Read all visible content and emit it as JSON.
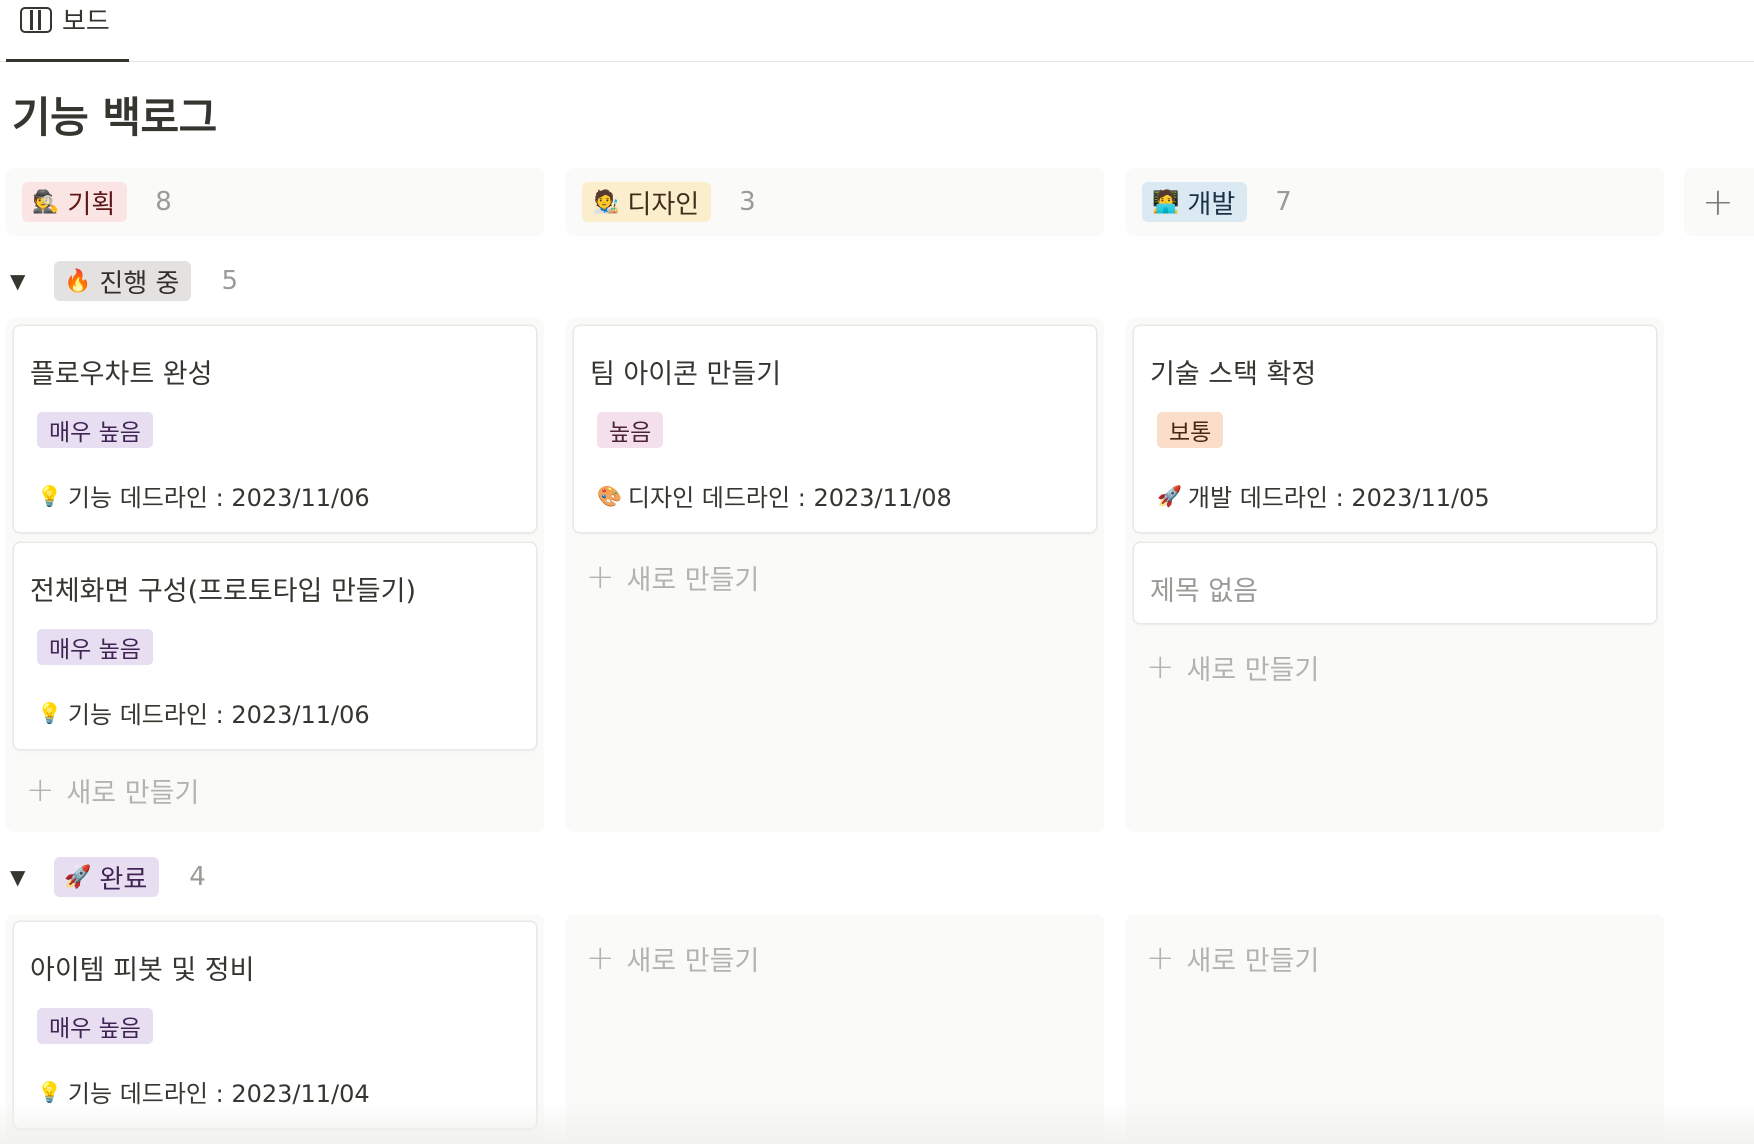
{
  "tab": {
    "label": "보드",
    "icon": "board-icon"
  },
  "page_title": "기능 백로그",
  "add_column_label": "+",
  "columns": [
    {
      "label": "기획",
      "emoji": "🕵️",
      "count": "8",
      "color": "#fbe4e4"
    },
    {
      "label": "디자인",
      "emoji": "🧑‍🎨",
      "count": "3",
      "color": "#fbeecd"
    },
    {
      "label": "개발",
      "emoji": "🧑‍💻",
      "count": "7",
      "color": "#dbe9f3"
    }
  ],
  "groups": [
    {
      "label": "진행 중",
      "emoji": "🔥",
      "count": "5",
      "color": "#e3e2e0"
    },
    {
      "label": "완료",
      "emoji": "🚀",
      "count": "4",
      "color": "#e8def2"
    }
  ],
  "cards": {
    "c1": {
      "title": "플로우차트 완성",
      "tag": "매우 높음",
      "tag_color": "#e8def2",
      "deadline_emoji": "💡",
      "deadline": "기능 데드라인 : 2023/11/06"
    },
    "c2": {
      "title": "전체화면 구성(프로토타입 만들기)",
      "tag": "매우 높음",
      "tag_color": "#e8def2",
      "deadline_emoji": "💡",
      "deadline": "기능 데드라인 : 2023/11/06"
    },
    "c3": {
      "title": "팀 아이콘 만들기",
      "tag": "높음",
      "tag_color": "#f4e0ec",
      "deadline_emoji": "🎨",
      "deadline": "디자인 데드라인 : 2023/11/08"
    },
    "c4": {
      "title": "기술 스택 확정",
      "tag": "보통",
      "tag_color": "#fadec9",
      "deadline_emoji": "🚀",
      "deadline": "개발 데드라인 : 2023/11/05"
    },
    "c5": {
      "title": "제목 없음"
    },
    "c6": {
      "title": "아이템 피봇 및 정비",
      "tag": "매우 높음",
      "tag_color": "#e8def2",
      "deadline_emoji": "💡",
      "deadline": "기능 데드라인 : 2023/11/04"
    }
  },
  "new_label": "새로 만들기"
}
